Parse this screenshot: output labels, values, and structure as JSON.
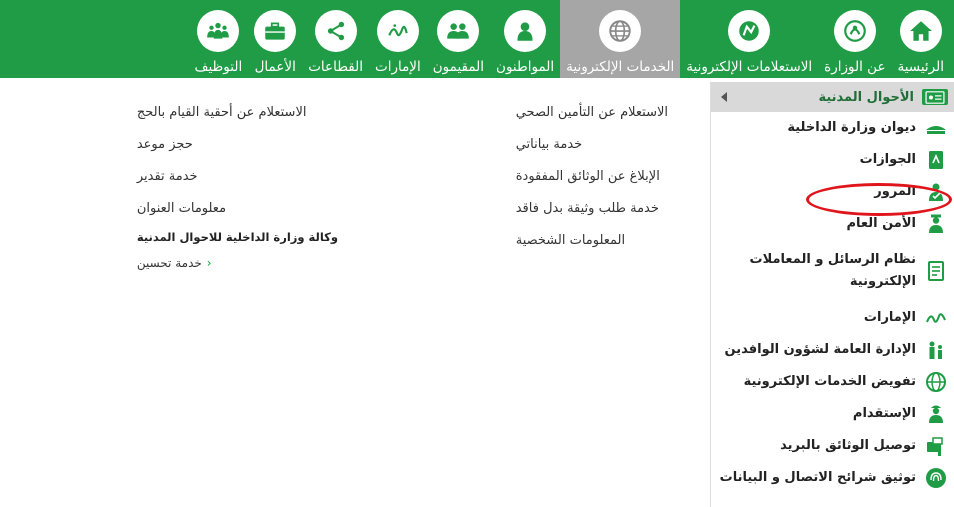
{
  "nav": {
    "items": [
      {
        "label": "الرئيسية",
        "icon": "home-icon"
      },
      {
        "label": "عن الوزارة",
        "icon": "ministry-emblem-icon"
      },
      {
        "label": "الاستعلامات الإلكترونية",
        "icon": "inquiry-icon"
      },
      {
        "label": "الخدمات الإلكترونية",
        "icon": "globe-icon",
        "active": true
      },
      {
        "label": "المواطنون",
        "icon": "citizen-icon"
      },
      {
        "label": "المقيمون",
        "icon": "residents-icon"
      },
      {
        "label": "الإمارات",
        "icon": "emirates-calligraphy-icon"
      },
      {
        "label": "القطاعات",
        "icon": "sectors-network-icon"
      },
      {
        "label": "الأعمال",
        "icon": "briefcase-icon"
      },
      {
        "label": "التوظيف",
        "icon": "employment-group-icon"
      }
    ]
  },
  "sidebar": {
    "header": "الأحوال المدنية",
    "items": [
      {
        "label": "ديوان وزارة الداخلية",
        "icon": "ministry-office-icon"
      },
      {
        "label": "الجوازات",
        "icon": "passport-icon"
      },
      {
        "label": "المرور",
        "icon": "traffic-officer-icon"
      },
      {
        "label": "الأمن العام",
        "icon": "police-officer-icon"
      },
      {
        "label": "نظام الرسائل و المعاملات الإلكترونية",
        "icon": "e-transactions-icon"
      },
      {
        "label": "الإمارات",
        "icon": "emirates-calligraphy-icon"
      },
      {
        "label": "الإدارة العامة لشؤون الوافدين",
        "icon": "expatriates-icon"
      },
      {
        "label": "تفويض الخدمات الإلكترونية",
        "icon": "globe-icon"
      },
      {
        "label": "الإستقدام",
        "icon": "recruitment-icon"
      },
      {
        "label": "توصيل الوثائق بالبريد",
        "icon": "mailbox-icon"
      },
      {
        "label": "توثيق شرائح الاتصال و البيانات",
        "icon": "fingerprint-icon"
      }
    ]
  },
  "content": {
    "col1": [
      "الاستعلام عن التأمين الصحي",
      "خدمة بياناتي",
      "الإبلاغ عن الوثائق المفقودة",
      "خدمة طلب وثيقة بدل فاقد",
      "المعلومات الشخصية"
    ],
    "col2": [
      "الاستعلام عن أحقية القيام بالحج",
      "حجز موعد",
      "خدمة تقدير",
      "معلومات العنوان"
    ],
    "agency": {
      "title": "وكالة وزارة الداخلية للاحوال المدنية",
      "items": [
        "خدمة تحسين"
      ]
    }
  },
  "colors": {
    "brand_green": "#1f9c45",
    "active_tab": "#a6a6a6",
    "highlight_red": "#e0141b"
  }
}
